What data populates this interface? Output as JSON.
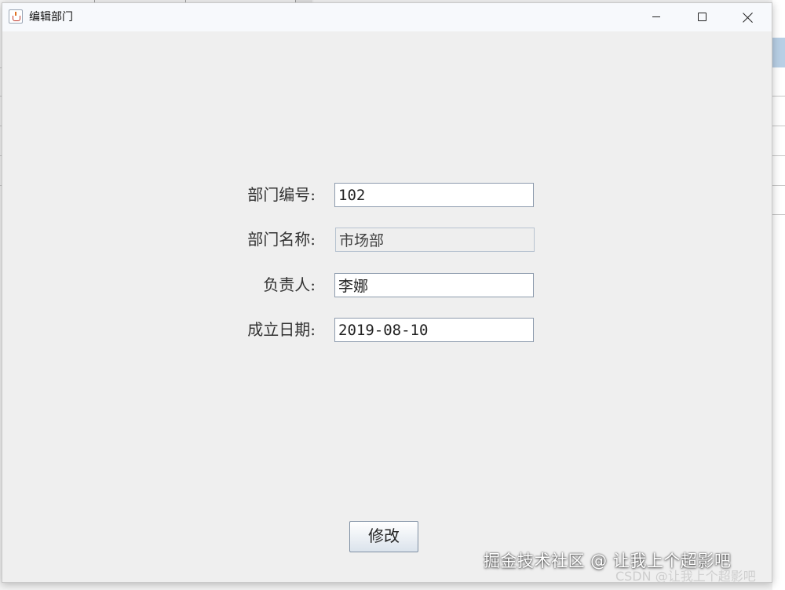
{
  "window": {
    "title": "编辑部门"
  },
  "form": {
    "dept_id_label": "部门编号:",
    "dept_id_value": "102",
    "dept_name_label": "部门名称:",
    "dept_name_value": "市场部",
    "manager_label": "负责人:",
    "manager_value": "李娜",
    "founded_label": "成立日期:",
    "founded_value": "2019-08-10"
  },
  "actions": {
    "submit_label": "修改"
  },
  "watermark": {
    "main": "掘金技术社区 @ 让我上个超影吧",
    "sub": "CSDN @让我上个超影吧"
  },
  "colors": {
    "dialog_bg": "#efefef",
    "input_border": "#8d9bad",
    "selected_row": "#b8cfe5"
  }
}
